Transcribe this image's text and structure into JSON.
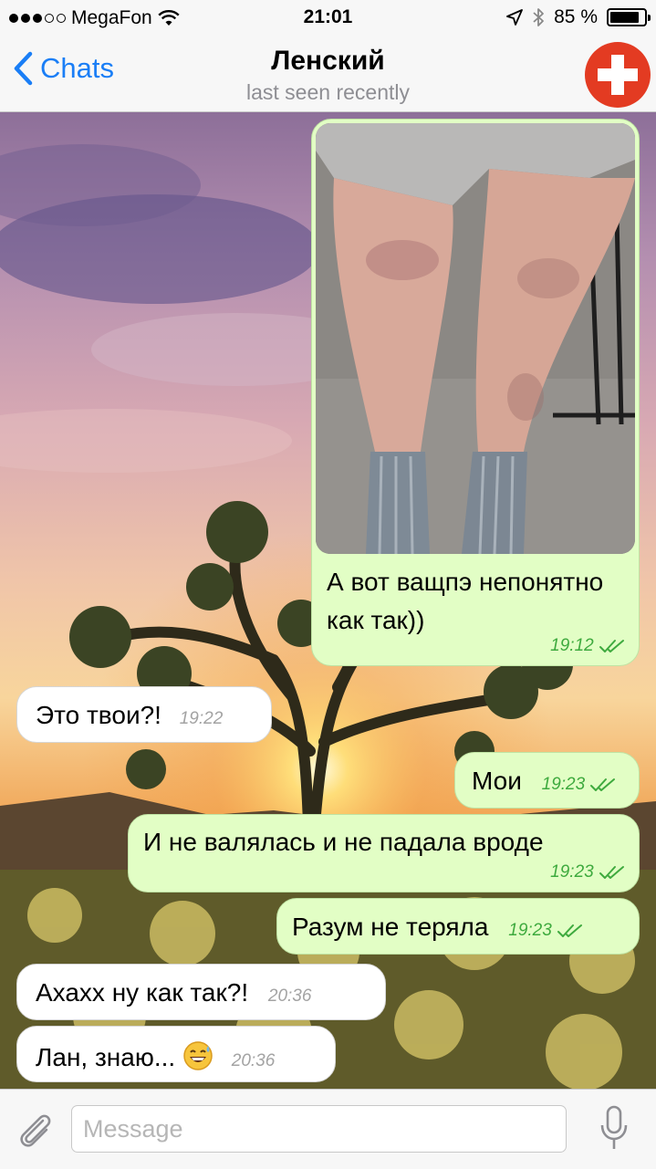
{
  "status_bar": {
    "carrier": "MegaFon",
    "time": "21:01",
    "battery": "85 %",
    "battery_level": 0.85,
    "signal_bars_filled": 3,
    "signal_bars_total": 5
  },
  "header": {
    "back_label": "Chats",
    "contact_name": "Ленский",
    "contact_status": "last seen recently",
    "avatar_color": "#e33b22"
  },
  "messages": [
    {
      "direction": "outgoing",
      "type": "photo",
      "text": "А вот ващпэ непонятно как так))",
      "time": "19:12",
      "read": true
    },
    {
      "direction": "incoming",
      "text": "Это твои?!",
      "time": "19:22"
    },
    {
      "direction": "outgoing",
      "text": "Мои",
      "time": "19:23",
      "read": true
    },
    {
      "direction": "outgoing",
      "text": "И не валялась и не падала вроде",
      "time": "19:23",
      "read": true
    },
    {
      "direction": "outgoing",
      "text": "Разум не теряла",
      "time": "19:23",
      "read": true
    },
    {
      "direction": "incoming",
      "text": "Ахахх ну как так?!",
      "time": "20:36"
    },
    {
      "direction": "incoming",
      "text": "Лан, знаю...",
      "emoji": "😅",
      "time": "20:36"
    }
  ],
  "input": {
    "placeholder": "Message",
    "value": ""
  },
  "colors": {
    "accent": "#1a7ef6",
    "outgoing_bubble": "#e2fec5",
    "incoming_bubble": "#ffffff",
    "read_ticks": "#3eaa3e"
  }
}
